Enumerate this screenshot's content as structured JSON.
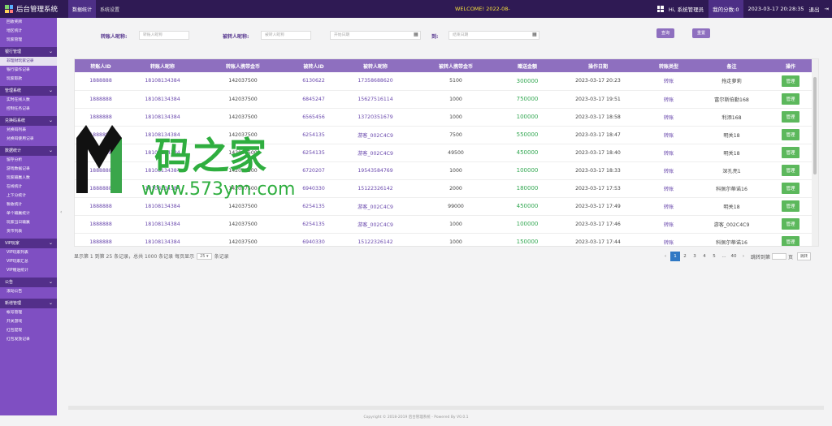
{
  "app": {
    "title": "后台管理系统"
  },
  "topbar": {
    "tabs": [
      "数据统计",
      "系统设置"
    ],
    "welcome": "WELCOME! 2022-08-",
    "user": "Hi, 系统管理员",
    "badge": "我的分数:0",
    "datetime": "2023-03-17 20:28:35",
    "logout": "退出"
  },
  "sidebar": {
    "items": [
      {
        "label": "回收奖牌",
        "type": "item"
      },
      {
        "label": "地区统计",
        "type": "item"
      },
      {
        "label": "玩家管理",
        "type": "item"
      },
      {
        "label": "银行管理",
        "type": "group"
      },
      {
        "label": "非理财玩家记录",
        "type": "item",
        "selected": true
      },
      {
        "label": "银行操作记录",
        "type": "item"
      },
      {
        "label": "玩家取款",
        "type": "item"
      },
      {
        "label": "管理系统",
        "type": "group"
      },
      {
        "label": "实时在线人数",
        "type": "item"
      },
      {
        "label": "控制任务记录",
        "type": "item"
      },
      {
        "label": "兑换码系统",
        "type": "group"
      },
      {
        "label": "兑换码列表",
        "type": "item"
      },
      {
        "label": "兑换码使用记录",
        "type": "item"
      },
      {
        "label": "数据统计",
        "type": "group"
      },
      {
        "label": "留存分析",
        "type": "item"
      },
      {
        "label": "游戏数据记录",
        "type": "item"
      },
      {
        "label": "玩家输赢人数",
        "type": "item"
      },
      {
        "label": "在线统计",
        "type": "item"
      },
      {
        "label": "上下分统计",
        "type": "item"
      },
      {
        "label": "税收统计",
        "type": "item"
      },
      {
        "label": "单个输赢统计",
        "type": "item"
      },
      {
        "label": "玩家当日输赢",
        "type": "item"
      },
      {
        "label": "货币列表",
        "type": "item"
      },
      {
        "label": "VIP玩家",
        "type": "group"
      },
      {
        "label": "VIP玩家列表",
        "type": "item"
      },
      {
        "label": "VIP玩家汇总",
        "type": "item"
      },
      {
        "label": "VIP赠送统计",
        "type": "item"
      },
      {
        "label": "公告",
        "type": "group"
      },
      {
        "label": "滚动公告",
        "type": "item"
      },
      {
        "label": "新增管理",
        "type": "group"
      },
      {
        "label": "帐号管理",
        "type": "item"
      },
      {
        "label": "开关游戏",
        "type": "item"
      },
      {
        "label": "红包提现",
        "type": "item"
      },
      {
        "label": "红包发放记录",
        "type": "item"
      }
    ]
  },
  "filter": {
    "label1": "转账人昵称:",
    "placeholder1": "转账人昵称",
    "label2": "被转人昵称:",
    "placeholder2": "被转人昵称",
    "placeholder_start": "开始日期",
    "label_to": "到:",
    "placeholder_end": "结束日期",
    "query_btn": "查询",
    "reset_btn": "重置"
  },
  "table": {
    "headers": [
      "转账人ID",
      "转账人昵称",
      "转账人携带金币",
      "被转人ID",
      "被转人昵称",
      "被转人携带金币",
      "赠送金额",
      "操作日期",
      "转账类型",
      "备注",
      "操作"
    ],
    "action_label": "管理",
    "rows": [
      [
        "1888888",
        "18108134384",
        "142037500",
        "6130622",
        "17358688620",
        "5100",
        "300000",
        "2023-03-17 20:23",
        "转账",
        "拖走萝莉"
      ],
      [
        "1888888",
        "18108134384",
        "142037500",
        "6845247",
        "15627516114",
        "1000",
        "750000",
        "2023-03-17 19:51",
        "转账",
        "富尔斯伯勤168"
      ],
      [
        "1888888",
        "18108134384",
        "142037500",
        "6565456",
        "13720351679",
        "1000",
        "100000",
        "2023-03-17 18:58",
        "转账",
        "利添168"
      ],
      [
        "1888888",
        "18108134384",
        "142037500",
        "6254135",
        "游客_002C4C9",
        "7500",
        "550000",
        "2023-03-17 18:47",
        "转账",
        "明关18"
      ],
      [
        "1888888",
        "18108134384",
        "142037500",
        "6254135",
        "游客_002C4C9",
        "49500",
        "450000",
        "2023-03-17 18:40",
        "转账",
        "明关18"
      ],
      [
        "1888888",
        "18108134384",
        "142037500",
        "6720207",
        "19543584769",
        "1000",
        "100000",
        "2023-03-17 18:33",
        "转账",
        "深孔亮1"
      ],
      [
        "1888888",
        "18108134384",
        "142037500",
        "6940330",
        "15122326142",
        "2000",
        "180000",
        "2023-03-17 17:53",
        "转账",
        "科佩尔蒂诺16"
      ],
      [
        "1888888",
        "18108134384",
        "142037500",
        "6254135",
        "游客_002C4C9",
        "99000",
        "450000",
        "2023-03-17 17:49",
        "转账",
        "明关18"
      ],
      [
        "1888888",
        "18108134384",
        "142037500",
        "6254135",
        "游客_002C4C9",
        "1000",
        "100000",
        "2023-03-17 17:46",
        "转账",
        "游客_002C4C9"
      ],
      [
        "1888888",
        "18108134384",
        "142037500",
        "6940330",
        "15122326142",
        "1000",
        "150000",
        "2023-03-17 17:44",
        "转账",
        "科佩尔蒂诺16"
      ]
    ]
  },
  "pagination": {
    "info_prefix": "显示第 1 到第 25 条记录，总共 1000 条记录 每页显示",
    "page_size": "25",
    "info_suffix": "条记录",
    "prev": "‹",
    "pages": [
      "1",
      "2",
      "3",
      "4",
      "5",
      "...",
      "40"
    ],
    "next": "›",
    "jump_label": "跳转到第",
    "jump_suffix": "页",
    "go": "跳转"
  },
  "watermark": {
    "main": "码之家",
    "sub": "www.573ym.com"
  },
  "footer": {
    "text": "Copyright © 2018-2019 后台管理系统 - Powered By V0.0.1"
  }
}
